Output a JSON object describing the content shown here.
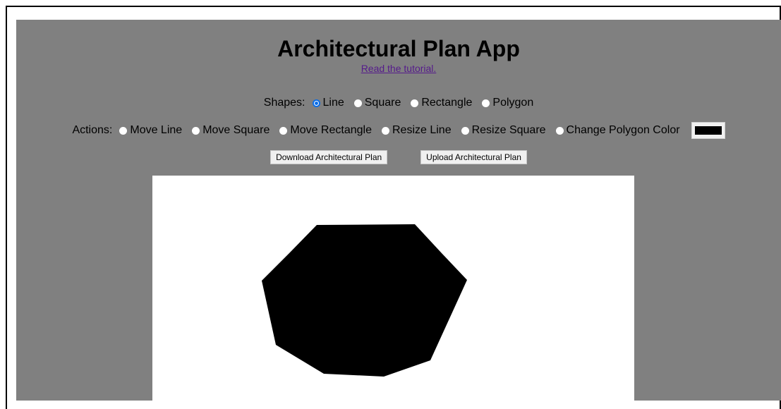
{
  "app": {
    "title": "Architectural Plan App",
    "tutorial_link": "Read the tutorial."
  },
  "shapes": {
    "label": "Shapes:",
    "options": [
      "Line",
      "Square",
      "Rectangle",
      "Polygon"
    ],
    "selected": "Line"
  },
  "actions": {
    "label": "Actions:",
    "options": [
      "Move Line",
      "Move Square",
      "Move Rectangle",
      "Resize Line",
      "Resize Square",
      "Change Polygon Color"
    ],
    "selected": null,
    "polygon_color": "#000000"
  },
  "buttons": {
    "download": "Download Architectural Plan",
    "upload": "Upload Architectural Plan"
  },
  "colors": {
    "app_background": "#808080",
    "canvas_background": "#ffffff",
    "radio_selected": "#0a6de8",
    "link": "#551a8b"
  }
}
